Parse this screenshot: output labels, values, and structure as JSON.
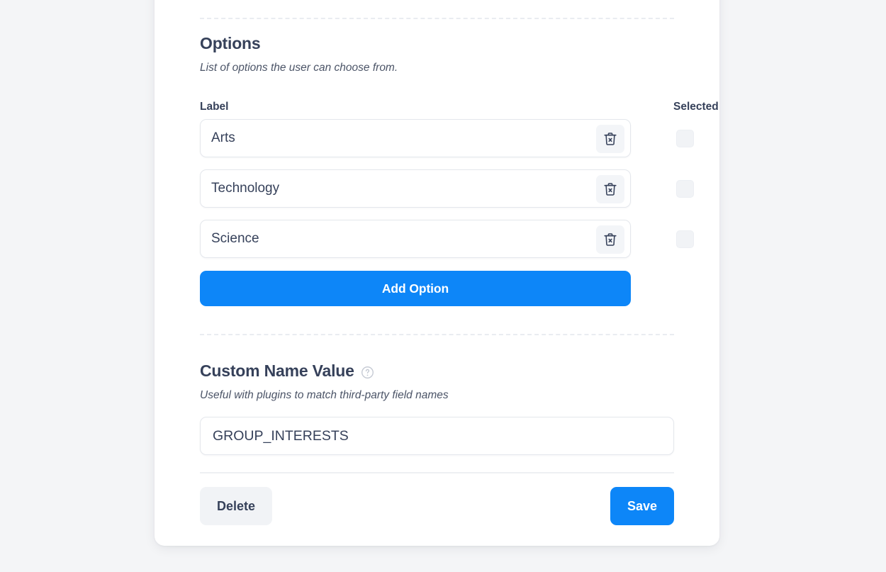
{
  "card": {
    "options_section": {
      "title": "Options",
      "description": "List of options the user can choose from.",
      "columns": {
        "label": "Label",
        "selected": "Selected"
      },
      "options": [
        {
          "label": "Arts",
          "selected": false,
          "delete_icon": "trash-x-icon"
        },
        {
          "label": "Technology",
          "selected": false,
          "delete_icon": "trash-x-icon"
        },
        {
          "label": "Science",
          "selected": false,
          "delete_icon": "trash-x-icon"
        }
      ],
      "add_option_label": "Add Option"
    },
    "custom_name_section": {
      "title": "Custom Name Value",
      "help_icon": "question-circle-icon",
      "description": "Useful with plugins to match third-party field names",
      "value": "GROUP_INTERESTS",
      "placeholder": ""
    },
    "footer": {
      "delete_label": "Delete",
      "save_label": "Save"
    }
  },
  "colors": {
    "accent": "#0d86f8",
    "text": "#36415a",
    "page_background": "#f4f5f7",
    "card_background": "#ffffff",
    "muted_surface": "#f1f3f6"
  }
}
